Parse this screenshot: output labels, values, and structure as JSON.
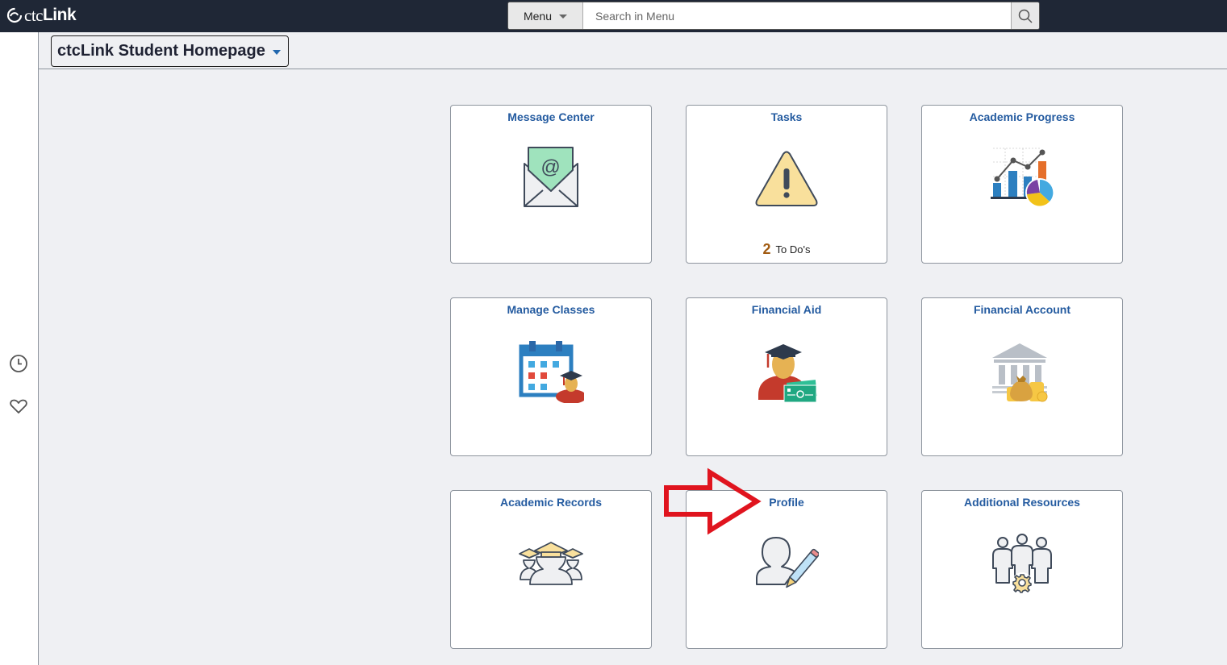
{
  "app": {
    "logo_ctc": "ctc",
    "logo_link": "Link"
  },
  "search": {
    "menu_label": "Menu",
    "placeholder": "Search in Menu",
    "value": ""
  },
  "sidebar": {
    "icons": [
      {
        "name": "recent-icon",
        "label": "Recently Visited"
      },
      {
        "name": "favorites-icon",
        "label": "Favorites"
      }
    ]
  },
  "homepage": {
    "title": "ctcLink Student Homepage"
  },
  "tiles": [
    {
      "title": "Message Center",
      "icon": "envelope-at-icon"
    },
    {
      "title": "Tasks",
      "icon": "warning-triangle-icon",
      "count": "2",
      "count_label": "To Do's"
    },
    {
      "title": "Academic Progress",
      "icon": "analytics-chart-icon"
    },
    {
      "title": "Manage Classes",
      "icon": "calendar-student-icon"
    },
    {
      "title": "Financial Aid",
      "icon": "graduate-money-icon"
    },
    {
      "title": "Financial Account",
      "icon": "bank-moneybag-icon"
    },
    {
      "title": "Academic Records",
      "icon": "graduates-group-icon"
    },
    {
      "title": "Profile",
      "icon": "user-edit-icon"
    },
    {
      "title": "Additional Resources",
      "icon": "people-gear-icon"
    }
  ],
  "annotation": {
    "arrow_color": "#e0141e",
    "points_to": "Profile"
  }
}
